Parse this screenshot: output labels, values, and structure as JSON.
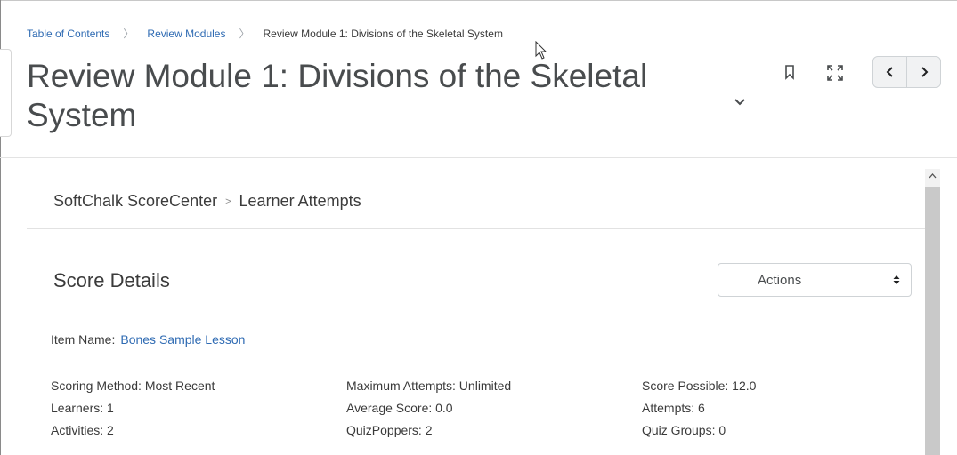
{
  "breadcrumb": {
    "items": [
      "Table of Contents",
      "Review Modules"
    ],
    "current": "Review Module 1: Divisions of the Skeletal System"
  },
  "page": {
    "title": "Review Module 1: Divisions of the Skeletal System"
  },
  "icons": {
    "title_dropdown": "chevron-down-icon",
    "bookmark": "bookmark-icon",
    "fullscreen": "fullscreen-icon",
    "previous": "chevron-left-icon",
    "next": "chevron-right-icon",
    "scroll_up": "scroll-up-arrow-icon",
    "cursor": "mouse-pointer-icon"
  },
  "scorecenter": {
    "breadcrumb": [
      "SoftChalk ScoreCenter",
      "Learner Attempts"
    ],
    "breadcrumb_separator": ">"
  },
  "score_details": {
    "title": "Score Details",
    "actions_label": "Actions",
    "item_name_label": "Item Name:",
    "item_name_value": "Bones Sample Lesson",
    "stats": [
      [
        "Scoring Method: Most Recent",
        "Maximum Attempts: Unlimited",
        "Score Possible: 12.0"
      ],
      [
        "Learners: 1",
        "Average Score: 0.0",
        "Attempts: 6"
      ],
      [
        "Activities:  2",
        "QuizPoppers:  2",
        "Quiz Groups:  0"
      ]
    ]
  },
  "colors": {
    "link": "#2f6bb3",
    "title_text": "#494c4e",
    "body_text": "#3a3a3a",
    "scrollbar_thumb": "#c9c9c9"
  }
}
